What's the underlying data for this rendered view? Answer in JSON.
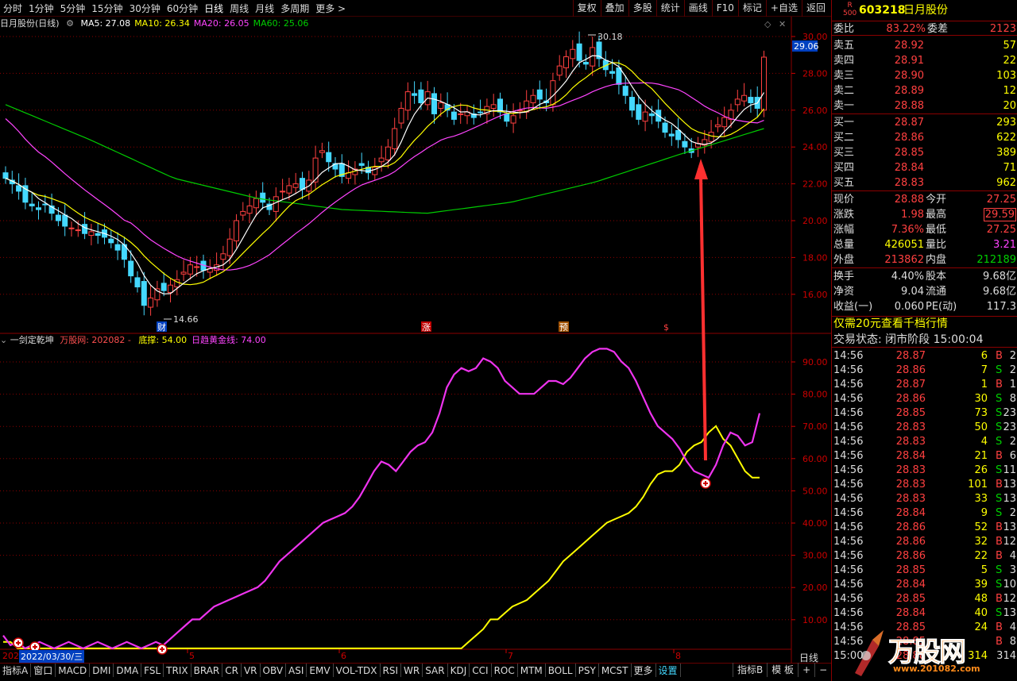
{
  "toolbar": {
    "periods": [
      "分时",
      "1分钟",
      "5分钟",
      "15分钟",
      "30分钟",
      "60分钟",
      "日线",
      "周线",
      "月线",
      "多周期",
      "更多 >"
    ],
    "active_period": "日线",
    "buttons": [
      "复权",
      "叠加",
      "多股",
      "统计",
      "画线",
      "F10",
      "标记",
      "+自选",
      "返回"
    ]
  },
  "main_chart": {
    "title": "日月股份(日线)",
    "ma_labels": [
      {
        "text": "MA5: 27.08",
        "color": "#ffffff"
      },
      {
        "text": "MA10: 26.34",
        "color": "#ffff00"
      },
      {
        "text": "MA20: 26.05",
        "color": "#ff44ff"
      },
      {
        "text": "MA60: 25.06",
        "color": "#00cc00"
      }
    ],
    "y_ticks": [
      "30.00",
      "28.00",
      "26.00",
      "24.00",
      "22.00",
      "20.00",
      "18.00",
      "16.00"
    ],
    "current_price_tag": "29.06",
    "high_label": "30.18",
    "low_label": "14.66",
    "markers": [
      "财",
      "涨",
      "预",
      "$"
    ]
  },
  "indicator": {
    "title": "一剑定乾坤",
    "source": "万股网: 202082 -",
    "labels": [
      {
        "text": "底撑: 54.00",
        "color": "#ffff00"
      },
      {
        "text": "日趋黄金线: 74.00",
        "color": "#ff44ff"
      }
    ],
    "y_ticks": [
      "90.00",
      "80.00",
      "70.00",
      "60.00",
      "50.00",
      "40.00",
      "30.00",
      "20.00",
      "10.00"
    ]
  },
  "x_axis": {
    "date_label": "2022/03/30/三",
    "prefix": "202",
    "months": [
      "5",
      "6",
      "7",
      "8"
    ],
    "period_label": "日线"
  },
  "bottom_tabs": [
    "指标A",
    "窗口",
    "MACD",
    "DMI",
    "DMA",
    "FSL",
    "TRIX",
    "BRAR",
    "CR",
    "VR",
    "OBV",
    "ASI",
    "EMV",
    "VOL-TDX",
    "RSI",
    "WR",
    "SAR",
    "KDJ",
    "CCI",
    "ROC",
    "MTM",
    "BOLL",
    "PSY",
    "MCST",
    "更多",
    "设置"
  ],
  "bottom_right": [
    "指标B",
    "模 板",
    "+",
    "−"
  ],
  "stock": {
    "badge_top": "R",
    "badge_bottom": "500",
    "code": "603218",
    "name": "日月股份",
    "weibi_label": "委比",
    "weibi": "83.22%",
    "weicha_label": "委差",
    "weicha": "2123"
  },
  "sell": [
    {
      "label": "卖五",
      "price": "28.92",
      "vol": "57"
    },
    {
      "label": "卖四",
      "price": "28.91",
      "vol": "22"
    },
    {
      "label": "卖三",
      "price": "28.90",
      "vol": "103"
    },
    {
      "label": "卖二",
      "price": "28.89",
      "vol": "12"
    },
    {
      "label": "卖一",
      "price": "28.88",
      "vol": "20"
    }
  ],
  "buy": [
    {
      "label": "买一",
      "price": "28.87",
      "vol": "293"
    },
    {
      "label": "买二",
      "price": "28.86",
      "vol": "622"
    },
    {
      "label": "买三",
      "price": "28.85",
      "vol": "389"
    },
    {
      "label": "买四",
      "price": "28.84",
      "vol": "71"
    },
    {
      "label": "买五",
      "price": "28.83",
      "vol": "962"
    }
  ],
  "quote": [
    {
      "l1": "现价",
      "v1": "28.88",
      "c1": "r",
      "l2": "今开",
      "v2": "27.25",
      "c2": "r"
    },
    {
      "l1": "涨跌",
      "v1": "1.98",
      "c1": "r",
      "l2": "最高",
      "v2": "29.59",
      "c2": "r",
      "box2": true
    },
    {
      "l1": "涨幅",
      "v1": "7.36%",
      "c1": "r",
      "l2": "最低",
      "v2": "27.25",
      "c2": "r"
    },
    {
      "l1": "总量",
      "v1": "426051",
      "c1": "y",
      "l2": "量比",
      "v2": "3.21",
      "c2": "m"
    },
    {
      "l1": "外盘",
      "v1": "213862",
      "c1": "r",
      "l2": "内盘",
      "v2": "212189",
      "c2": "g"
    }
  ],
  "finance": [
    {
      "l1": "换手",
      "v1": "4.40%",
      "l2": "股本",
      "v2": "9.68亿"
    },
    {
      "l1": "净资",
      "v1": "9.04",
      "l2": "流通",
      "v2": "9.68亿"
    },
    {
      "l1": "收益(一)",
      "v1": "0.060",
      "l2": "PE(动)",
      "v2": "117.3"
    }
  ],
  "promo": "仅需20元查看千档行情",
  "trade_status": "交易状态: 闭市阶段 15:00:04",
  "ticks": [
    {
      "t": "14:56",
      "p": "28.87",
      "v": "6",
      "bs": "B",
      "n": "2"
    },
    {
      "t": "14:56",
      "p": "28.86",
      "v": "7",
      "bs": "S",
      "n": "2"
    },
    {
      "t": "14:56",
      "p": "28.87",
      "v": "1",
      "bs": "B",
      "n": "1"
    },
    {
      "t": "14:56",
      "p": "28.86",
      "v": "30",
      "bs": "S",
      "n": "8"
    },
    {
      "t": "14:56",
      "p": "28.85",
      "v": "73",
      "bs": "S",
      "n": "23"
    },
    {
      "t": "14:56",
      "p": "28.83",
      "v": "50",
      "bs": "S",
      "n": "23"
    },
    {
      "t": "14:56",
      "p": "28.83",
      "v": "4",
      "bs": "S",
      "n": "2"
    },
    {
      "t": "14:56",
      "p": "28.84",
      "v": "21",
      "bs": "B",
      "n": "6"
    },
    {
      "t": "14:56",
      "p": "28.83",
      "v": "26",
      "bs": "S",
      "n": "11"
    },
    {
      "t": "14:56",
      "p": "28.83",
      "v": "101",
      "bs": "B",
      "n": "13"
    },
    {
      "t": "14:56",
      "p": "28.83",
      "v": "33",
      "bs": "S",
      "n": "13"
    },
    {
      "t": "14:56",
      "p": "28.84",
      "v": "9",
      "bs": "S",
      "n": "2"
    },
    {
      "t": "14:56",
      "p": "28.86",
      "v": "52",
      "bs": "B",
      "n": "13"
    },
    {
      "t": "14:56",
      "p": "28.86",
      "v": "32",
      "bs": "B",
      "n": "12"
    },
    {
      "t": "14:56",
      "p": "28.86",
      "v": "22",
      "bs": "B",
      "n": "4"
    },
    {
      "t": "14:56",
      "p": "28.85",
      "v": "5",
      "bs": "S",
      "n": "3"
    },
    {
      "t": "14:56",
      "p": "28.84",
      "v": "39",
      "bs": "S",
      "n": "10"
    },
    {
      "t": "14:56",
      "p": "28.85",
      "v": "48",
      "bs": "B",
      "n": "12"
    },
    {
      "t": "14:56",
      "p": "28.84",
      "v": "40",
      "bs": "S",
      "n": "13"
    },
    {
      "t": "14:56",
      "p": "28.85",
      "v": "24",
      "bs": "B",
      "n": "4"
    },
    {
      "t": "14:56",
      "p": "28.85",
      "v": "",
      "bs": "B",
      "n": "8"
    },
    {
      "t": "15:00",
      "p": "28.88",
      "v": "314",
      "bs": "",
      "n": "314"
    }
  ],
  "watermark": {
    "brand": "万股网",
    "url": "www.201082.com"
  },
  "colors": {
    "up": "#ff4040",
    "down": "#44d8ff",
    "ma5": "#ffffff",
    "ma10": "#ffff00",
    "ma20": "#ff44ff",
    "ma60": "#00cc00",
    "grid": "#8b0000",
    "arrow": "#ff3030"
  }
}
